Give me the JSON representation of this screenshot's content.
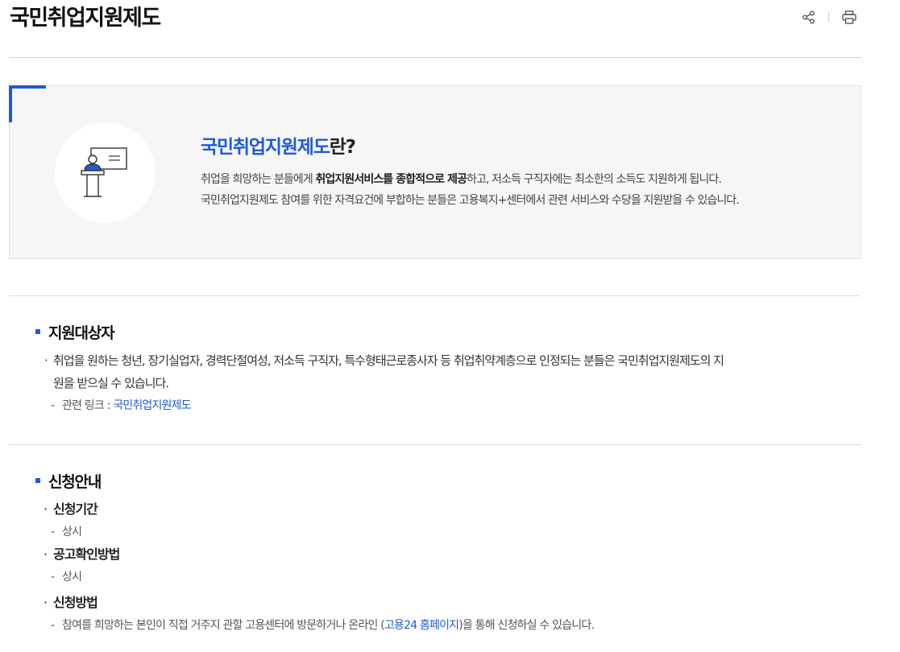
{
  "header": {
    "title": "국민취업지원제도",
    "share_icon": "share-icon",
    "print_icon": "print-icon"
  },
  "intro": {
    "title_accent": "국민취업지원제도",
    "title_rest": "란?",
    "line1_pre": "취업을 희망하는 분들에게 ",
    "line1_bold": "취업지원서비스를 종합적으로 제공",
    "line1_post": "하고, 저소득 구직자에는 최소한의 소득도 지원하게 됩니다.",
    "line2": "국민취업지원제도 참여를 위한 자격요건에 부합하는 분들은 고용복지+센터에서 관련 서비스와 수당을 지원받을 수 있습니다.",
    "illustration_icon": "presenter-podium-icon",
    "accent_color": "#1f5bd6"
  },
  "target": {
    "title": "지원대상자",
    "bullet_line1": "취업을 원하는 청년, 장기실업자, 경력단절여성, 저소득 구직자, 특수형태근로종사자 등 취업취약계층으로 인정되는 분들은 국민취업지원제도의 지",
    "bullet_line2": "원을 받으실 수 있습니다.",
    "link_label": "관련 링크 : ",
    "link_text": "국민취업지원제도"
  },
  "apply": {
    "title": "신청안내",
    "period_title": "신청기간",
    "period_value": "상시",
    "notice_title": "공고확인방법",
    "notice_value": "상시",
    "method_title": "신청방법",
    "method_pre": "참여를 희망하는 본인이 직접 거주지 관할 고용센터에 방문하거나 온라인 (",
    "method_link": "고용24 홈페이지",
    "method_post": ")을 통해 신청하실 수 있습니다."
  }
}
